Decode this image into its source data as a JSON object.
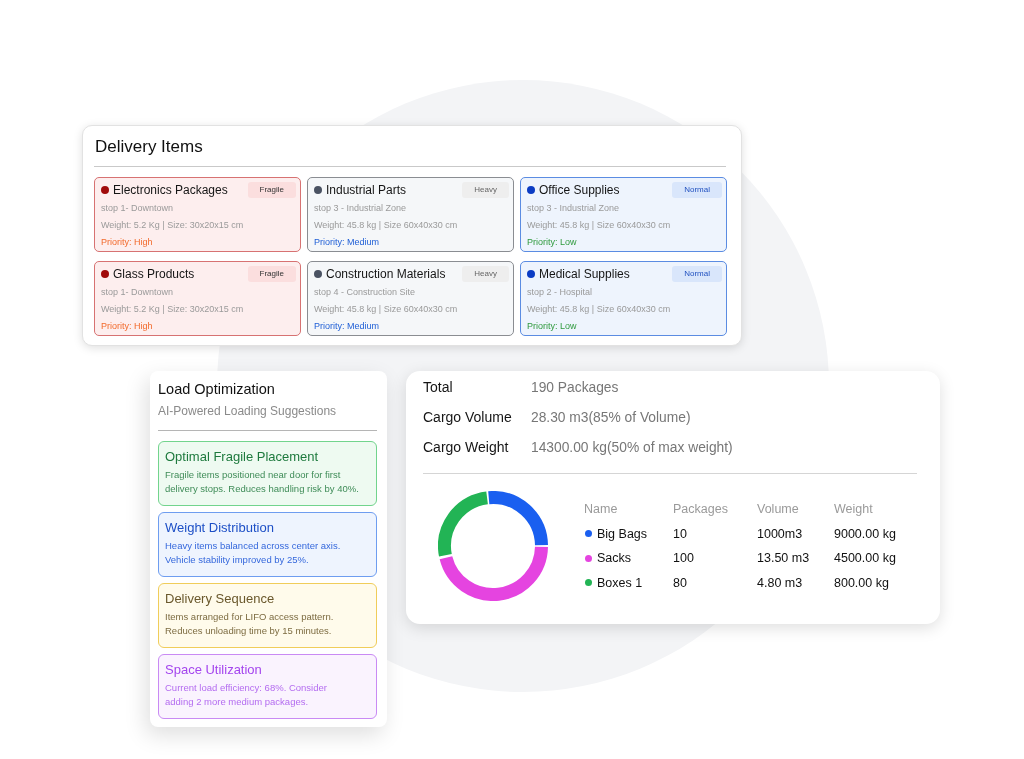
{
  "delivery_items": {
    "title": "Delivery Items",
    "items": [
      {
        "kind": "fragile",
        "color": "#a10a0a",
        "name": "Electronics Packages",
        "tag": "Fragile",
        "stop": "stop 1- Downtown",
        "details": "Weight: 5.2 Kg | Size: 30x20x15 cm",
        "priority": "Priority: High"
      },
      {
        "kind": "heavy",
        "color": "#4a5262",
        "name": "Industrial Parts",
        "tag": "Heavy",
        "stop": "stop 3 - Industrial Zone",
        "details": "Weight: 45.8 kg | Size 60x40x30 cm",
        "priority": "Priority: Medium"
      },
      {
        "kind": "normal",
        "color": "#0b3cc4",
        "name": "Office Supplies",
        "tag": "Normal",
        "stop": "stop 3 - Industrial Zone",
        "details": "Weight: 45.8 kg | Size 60x40x30 cm",
        "priority": "Priority: Low"
      },
      {
        "kind": "fragile",
        "color": "#a10a0a",
        "name": "Glass Products",
        "tag": "Fragile",
        "stop": "stop 1- Downtown",
        "details": "Weight: 5.2 Kg | Size: 30x20x15 cm",
        "priority": "Priority: High"
      },
      {
        "kind": "heavy",
        "color": "#4a5262",
        "name": "Construction Materials",
        "tag": "Heavy",
        "stop": "stop 4 - Construction Site",
        "details": "Weight: 45.8 kg | Size 60x40x30 cm",
        "priority": "Priority: Medium"
      },
      {
        "kind": "normal",
        "color": "#0b3cc4",
        "name": "Medical Supplies",
        "tag": "Normal",
        "stop": "stop 2 - Hospital",
        "details": "Weight: 45.8 kg | Size 60x40x30 cm",
        "priority": "Priority: Low"
      }
    ]
  },
  "load_optimization": {
    "title": "Load Optimization",
    "subtitle": "AI-Powered Loading Suggestions",
    "suggestions": [
      {
        "kind": "success",
        "title": "Optimal Fragile Placement",
        "lines": [
          "Fragile items positioned near door for first",
          "delivery stops. Reduces handling risk by 40%."
        ]
      },
      {
        "kind": "info",
        "title": "Weight Distribution",
        "lines": [
          "Heavy items balanced across center axis.",
          "Vehicle stability improved by 25%."
        ]
      },
      {
        "kind": "warning",
        "title": "Delivery Sequence",
        "lines": [
          "Items arranged for LIFO access pattern.",
          "Reduces unloading time by 15 minutes."
        ]
      },
      {
        "kind": "accent",
        "title": "Space Utilization",
        "lines": [
          "Current load efficiency: 68%. Consider",
          "adding 2 more medium packages."
        ]
      }
    ]
  },
  "cargo_summary": {
    "stats": [
      {
        "label": "Total",
        "value": "190 Packages"
      },
      {
        "label": "Cargo Volume",
        "value": "28.30 m3(85% of Volume)"
      },
      {
        "label": "Cargo Weight",
        "value": "14300.00 kg(50% of max weight)"
      }
    ],
    "table": {
      "columns": [
        "Name",
        "Packages",
        "Volume",
        "Weight"
      ],
      "rows": [
        {
          "color": "#1a5ff0",
          "name": "Big Bags",
          "packages": "10",
          "volume": "1000m3",
          "weight": "9000.00 kg"
        },
        {
          "color": "#e544e0",
          "name": "Sacks",
          "packages": "100",
          "volume": "13.50 m3",
          "weight": "4500.00 kg"
        },
        {
          "color": "#22b455",
          "name": "Boxes 1",
          "packages": "80",
          "volume": "4.80 m3",
          "weight": "800.00 kg"
        }
      ]
    }
  }
}
